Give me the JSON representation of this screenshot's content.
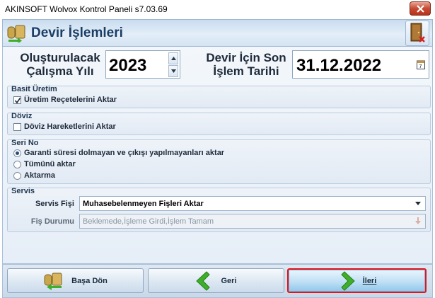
{
  "window": {
    "title": "AKINSOFT Wolvox Kontrol Paneli s7.03.69"
  },
  "header": {
    "title": "Devir İşlemleri"
  },
  "year": {
    "label_line1": "Oluşturulacak",
    "label_line2": "Çalışma Yılı",
    "value": "2023"
  },
  "date": {
    "label_line1": "Devir İçin Son",
    "label_line2": "İşlem Tarihi",
    "value": "31.12.2022"
  },
  "basic_production": {
    "title": "Basit Üretim",
    "option_label": "Üretim Reçetelerini Aktar",
    "checked": true
  },
  "currency": {
    "title": "Döviz",
    "option_label": "Döviz Hareketlerini Aktar",
    "checked": false
  },
  "serial": {
    "title": "Seri No",
    "options": [
      {
        "label": "Garanti süresi dolmayan ve çıkışı yapılmayanları aktar",
        "selected": true
      },
      {
        "label": "Tümünü aktar",
        "selected": false
      },
      {
        "label": "Aktarma",
        "selected": false
      }
    ]
  },
  "service": {
    "title": "Servis",
    "slip_label": "Servis Fişi",
    "slip_value": "Muhasebelenmeyen Fişleri Aktar",
    "status_label": "Fiş Durumu",
    "status_value": "Beklemede,İşleme Girdi,İşlem Tamam"
  },
  "buttons": {
    "home": "Başa Dön",
    "back": "Geri",
    "next": "İleri"
  },
  "colors": {
    "accent": "#1b3d66",
    "highlight_border": "#e0151b",
    "arrow_green": "#3fae2a"
  }
}
